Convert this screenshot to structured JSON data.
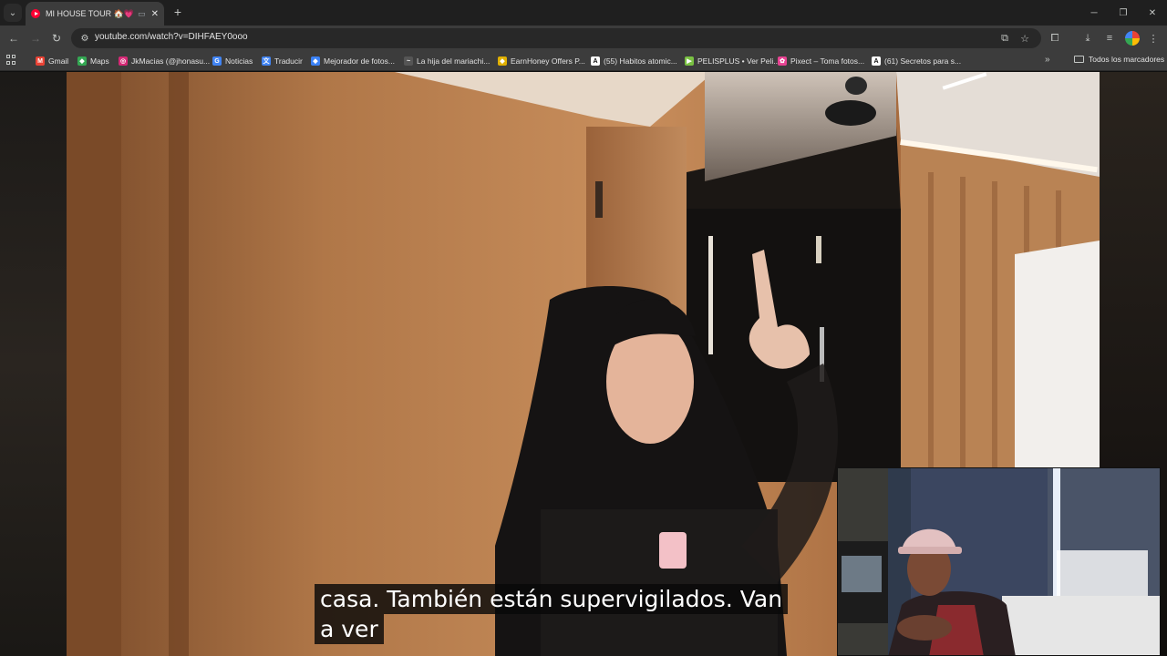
{
  "browser": {
    "tab": {
      "title": "MI HOUSE TOUR 🏠💗 - YouTube",
      "cast_icon": "cast-icon"
    },
    "window_controls": {
      "minimize": "─",
      "restore": "❐",
      "close": "✕"
    },
    "new_tab": "+",
    "omnibox": {
      "url": "youtube.com/watch?v=DIHFAEY0ooo"
    },
    "bookmarks": [
      {
        "label": "Gmail",
        "icon_color": "#ea4335",
        "icon_text": "M"
      },
      {
        "label": "Maps",
        "icon_color": "#34a853",
        "icon_text": "◆"
      },
      {
        "label": "JkMacias (@jhonasu...",
        "icon_color": "#d62976",
        "icon_text": "◎"
      },
      {
        "label": "Noticias",
        "icon_color": "#4285f4",
        "icon_text": "G"
      },
      {
        "label": "Traducir",
        "icon_color": "#4285f4",
        "icon_text": "文"
      },
      {
        "label": "Mejorador de fotos...",
        "icon_color": "#3b82f6",
        "icon_text": "◆"
      },
      {
        "label": "La hija del mariachi...",
        "icon_color": "#555555",
        "icon_text": "~"
      },
      {
        "label": "EarnHoney Offers P...",
        "icon_color": "#e0b000",
        "icon_text": "◆"
      },
      {
        "label": "(55) Habitos atomic...",
        "icon_color": "#ffffff",
        "icon_text": "A"
      },
      {
        "label": "PELISPLUS • Ver Peli...",
        "icon_color": "#7ac143",
        "icon_text": "▶"
      },
      {
        "label": "Pixect – Toma fotos...",
        "icon_color": "#e84393",
        "icon_text": "✿"
      },
      {
        "label": "(61) Secretos para s...",
        "icon_color": "#ffffff",
        "icon_text": "A"
      }
    ],
    "bookmarks_more": "»",
    "bookmarks_folder": "Todos los marcadores"
  },
  "video": {
    "subtitle_lines": [
      "casa. También están supervigilados. Van",
      "a ver"
    ]
  }
}
